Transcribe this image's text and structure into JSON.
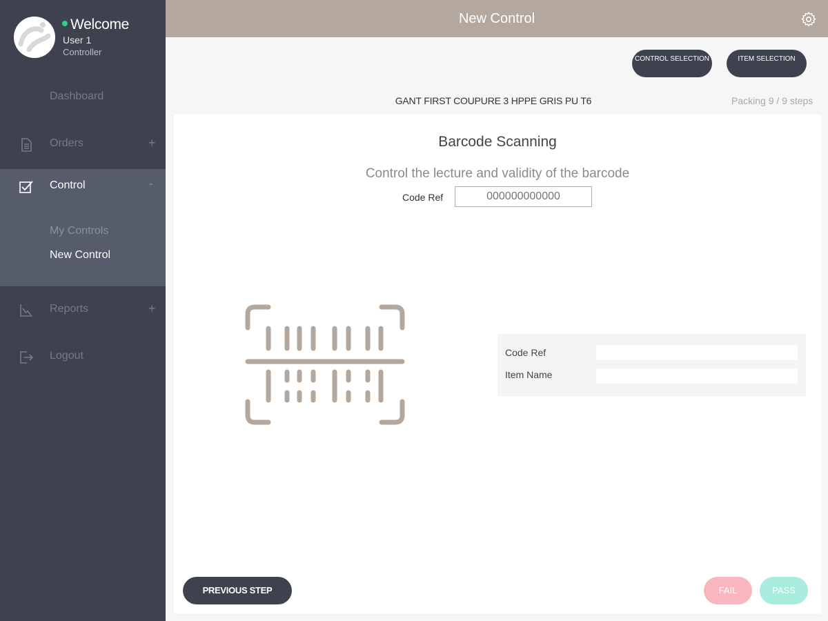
{
  "profile": {
    "welcome": "Welcome",
    "username": "User 1",
    "role": "Controller",
    "status_color": "#2ed27a"
  },
  "sidebar": {
    "dashboard": "Dashboard",
    "orders": "Orders",
    "control": "Control",
    "control_submenu": [
      "My Controls",
      "New Control"
    ],
    "reports": "Reports",
    "logout": "Logout",
    "expand_symbol": "+",
    "collapse_symbol": "-"
  },
  "header": {
    "title": "New Control",
    "settings_icon": "gear-icon"
  },
  "toolbar": {
    "control_selection": "CONTROL SELECTION",
    "item_selection": "ITEM SELECTION"
  },
  "product": {
    "name": "GANT FIRST COUPURE 3 HPPE GRIS PU T6",
    "steps": "Packing 9 / 9 steps"
  },
  "scan": {
    "title": "Barcode Scanning",
    "subtitle": "Control the lecture and validity of the barcode",
    "code_ref_label": "Code Ref",
    "code_ref_placeholder": "000000000000"
  },
  "info": {
    "code_ref_label": "Code Ref",
    "item_name_label": "Item Name"
  },
  "actions": {
    "previous": "PREVIOUS STEP",
    "fail": "FAIL",
    "pass": "PASS"
  },
  "colors": {
    "sidebar": "#3d424e",
    "accent": "#b3a79e",
    "fail": "#f8b6bf",
    "pass": "#a8ecdd"
  }
}
